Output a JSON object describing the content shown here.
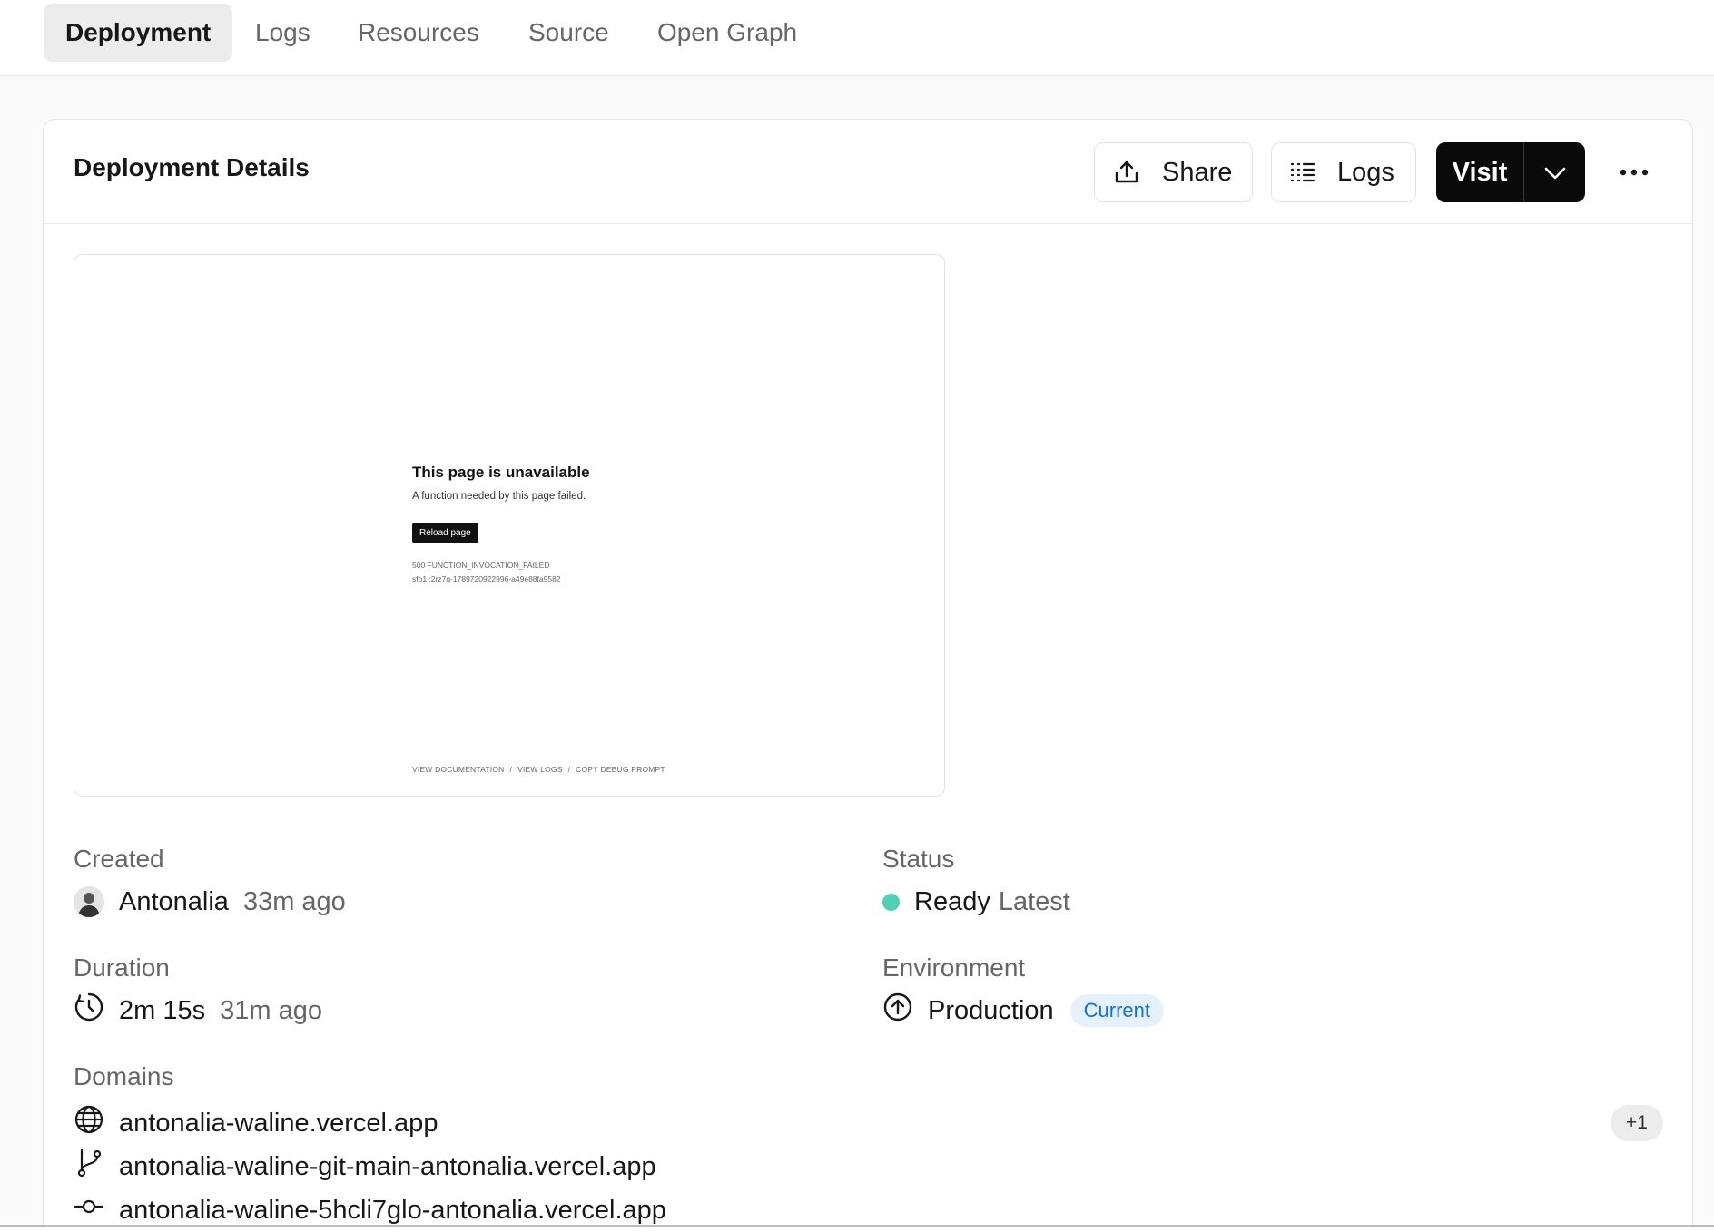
{
  "tabs": [
    {
      "label": "Deployment",
      "active": true
    },
    {
      "label": "Logs",
      "active": false
    },
    {
      "label": "Resources",
      "active": false
    },
    {
      "label": "Source",
      "active": false
    },
    {
      "label": "Open Graph",
      "active": false
    }
  ],
  "card": {
    "title": "Deployment Details",
    "share_label": "Share",
    "logs_label": "Logs",
    "visit_label": "Visit"
  },
  "preview": {
    "title": "This page is unavailable",
    "subtitle": "A function needed by this page failed.",
    "button": "Reload page",
    "code_line1": "500 FUNCTION_INVOCATION_FAILED",
    "code_line2": "sfo1::2rz7q-1789720922996-a49e88fa9582",
    "footer": [
      "VIEW DOCUMENTATION",
      "VIEW LOGS",
      "COPY DEBUG PROMPT"
    ],
    "footer_sep": "/"
  },
  "created": {
    "label": "Created",
    "user": "Antonalia",
    "time": "33m ago"
  },
  "status": {
    "label": "Status",
    "value": "Ready",
    "note": "Latest",
    "color": "#4fd1b5"
  },
  "duration": {
    "label": "Duration",
    "value": "2m 15s",
    "time": "31m ago"
  },
  "environment": {
    "label": "Environment",
    "value": "Production",
    "badge": "Current"
  },
  "domains": {
    "label": "Domains",
    "items": [
      {
        "icon": "globe-icon",
        "text": "antonalia-waline.vercel.app"
      },
      {
        "icon": "git-branch-icon",
        "text": "antonalia-waline-git-main-antonalia.vercel.app"
      },
      {
        "icon": "git-commit-icon",
        "text": "antonalia-waline-5hcli7glo-antonalia.vercel.app"
      }
    ],
    "more": "+1"
  }
}
